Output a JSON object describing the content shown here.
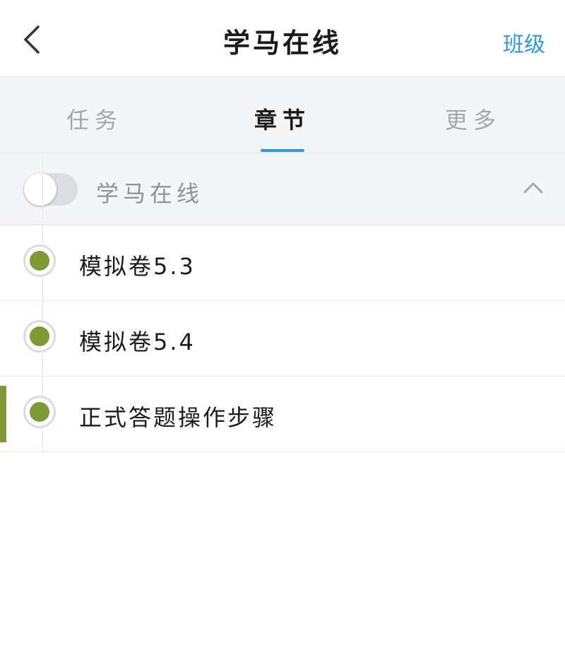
{
  "header": {
    "title": "学马在线",
    "action_label": "班级"
  },
  "tabs": [
    {
      "label": "任务",
      "active": false
    },
    {
      "label": "章节",
      "active": true
    },
    {
      "label": "更多",
      "active": false
    }
  ],
  "section": {
    "title": "学马在线",
    "toggle_on": false,
    "expanded": true
  },
  "chapters": [
    {
      "label": "模拟卷5.3",
      "status": "completed",
      "current": false
    },
    {
      "label": "模拟卷5.4",
      "status": "completed",
      "current": false
    },
    {
      "label": "正式答题操作步骤",
      "status": "completed",
      "current": true
    }
  ],
  "colors": {
    "accent_blue": "#2a9be0",
    "status_green": "#7f9a35"
  }
}
